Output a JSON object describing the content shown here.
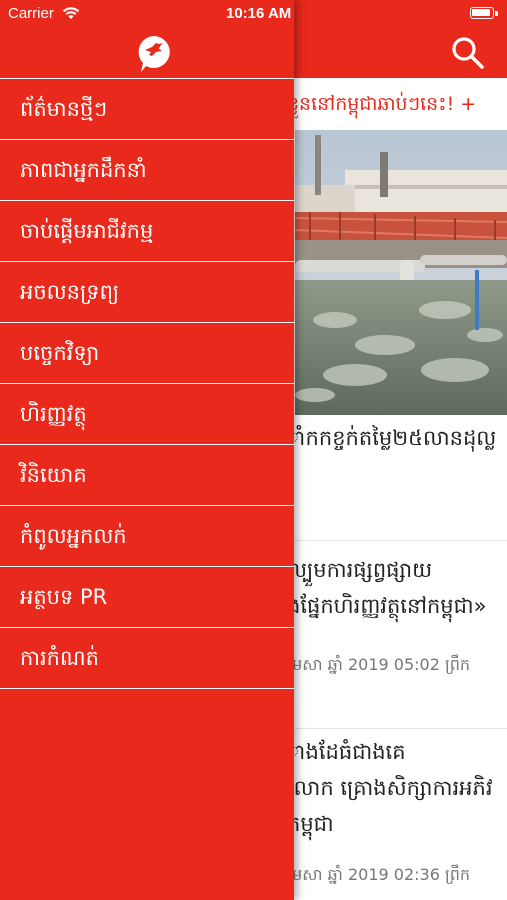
{
  "status_bar": {
    "carrier": "Carrier",
    "time": "10:16 AM"
  },
  "colors": {
    "brand_red": "#e8291c"
  },
  "drawer": {
    "logo_icon": "bird-speech-bubble-logo",
    "items": [
      "ព័ត៌មានថ្មីៗ",
      "ភាពជាអ្នកដឹកនាំ",
      "ចាប់ផ្តើមអាជីវកម្ម",
      "អចលនទ្រព្យ",
      "បច្ចេកវិទ្យា",
      "ហិរញ្ញវត្ថុ",
      "វិនិយោគ",
      "កំពូលអ្នកលក់",
      "អត្ថបទ PR",
      "ការកំណត់"
    ]
  },
  "main": {
    "search_icon": "search-icon",
    "ticker": "ខ្លួននៅកម្ពុជាឆាប់ៗនេះ! +",
    "articles": [
      {
        "title_1": "ាំកកខ្ចក់តម្លៃ២៥លានដុល្ល"
      },
      {
        "title_1": "ល្បួមការផ្សព្វផ្សាយ",
        "title_2": "ងផ្នែកហិរញ្ញវត្ថុនៅកម្ពុជា»",
        "meta": "មេសា ឆ្នាំ 2019 05:02 ព្រឹក"
      },
      {
        "title_1": "ាងដែធំជាងគេ",
        "title_2": "លោក គ្រោងសិក្សាការអភិវ",
        "title_3": "កម្ពុជា",
        "meta": "មេសា ឆ្នាំ 2019 02:36 ព្រឹក"
      }
    ]
  }
}
